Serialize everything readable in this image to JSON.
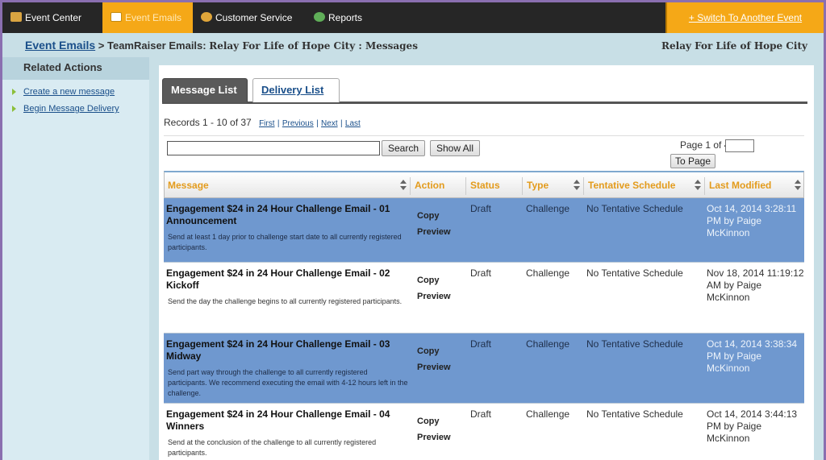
{
  "nav": {
    "items": [
      {
        "label": "Event Center",
        "icon": "house-icon"
      },
      {
        "label": "Event Emails",
        "icon": "envelope-icon"
      },
      {
        "label": "Customer Service",
        "icon": "people-icon"
      },
      {
        "label": "Reports",
        "icon": "chart-icon"
      }
    ],
    "switch_label": "+ Switch To Another Event"
  },
  "breadcrumb": {
    "link": "Event Emails",
    "separator": ">",
    "middle": "TeamRaiser Emails:",
    "page": "Relay For Life of Hope City : Messages",
    "right": "Relay For Life of Hope City"
  },
  "sidebar": {
    "heading": "Related Actions",
    "items": [
      "Create a new message",
      "Begin Message Delivery"
    ]
  },
  "tabs": [
    "Message List",
    "Delivery List"
  ],
  "records": {
    "summary": "Records 1 - 10 of 37",
    "first": "First",
    "previous": "Previous",
    "next": "Next",
    "last": "Last",
    "sep": "|"
  },
  "search": {
    "value": "",
    "search_label": "Search",
    "show_all_label": "Show All",
    "page_of": "Page 1 of 4",
    "page_value": "",
    "to_page_label": "To Page"
  },
  "table": {
    "headers": [
      "Message",
      "Action",
      "Status",
      "Type",
      "Tentative Schedule",
      "Last Modified"
    ],
    "rows": [
      {
        "title": "Engagement $24 in 24 Hour Challenge Email - 01 Announcement",
        "desc": "Send at least 1 day prior to challenge start date to all currently registered participants.",
        "actions": [
          "Copy",
          "Preview"
        ],
        "status": "Draft",
        "type": "Challenge",
        "schedule": "No Tentative Schedule",
        "modified": "Oct 14, 2014 3:28:11 PM by Paige McKinnon"
      },
      {
        "title": "Engagement $24 in 24 Hour Challenge Email - 02 Kickoff",
        "desc": "Send the day the challenge begins to all currently registered participants.",
        "actions": [
          "Copy",
          "Preview"
        ],
        "status": "Draft",
        "type": "Challenge",
        "schedule": "No Tentative Schedule",
        "modified": "Nov 18, 2014 11:19:12 AM by Paige McKinnon"
      },
      {
        "title": "Engagement $24 in 24 Hour Challenge Email - 03 Midway",
        "desc": "Send part way through the challenge to all currently registered participants. We recommend executing the email with 4-12 hours left in the challenge.",
        "actions": [
          "Copy",
          "Preview"
        ],
        "status": "Draft",
        "type": "Challenge",
        "schedule": "No Tentative Schedule",
        "modified": "Oct 14, 2014 3:38:34 PM by Paige McKinnon"
      },
      {
        "title": "Engagement $24 in 24 Hour Challenge Email - 04 Winners",
        "desc": "Send at the conclusion of the challenge to all currently registered participants.",
        "actions": [
          "Copy",
          "Preview"
        ],
        "status": "Draft",
        "type": "Challenge",
        "schedule": "No Tentative Schedule",
        "modified": "Oct 14, 2014 3:44:13 PM by Paige McKinnon"
      }
    ]
  },
  "colors": {
    "accent": "#f5a817",
    "nav_bg": "#262626",
    "highlight_row": "#6f98cf",
    "header_text": "#e39b1c",
    "link": "#1a4f8a"
  }
}
